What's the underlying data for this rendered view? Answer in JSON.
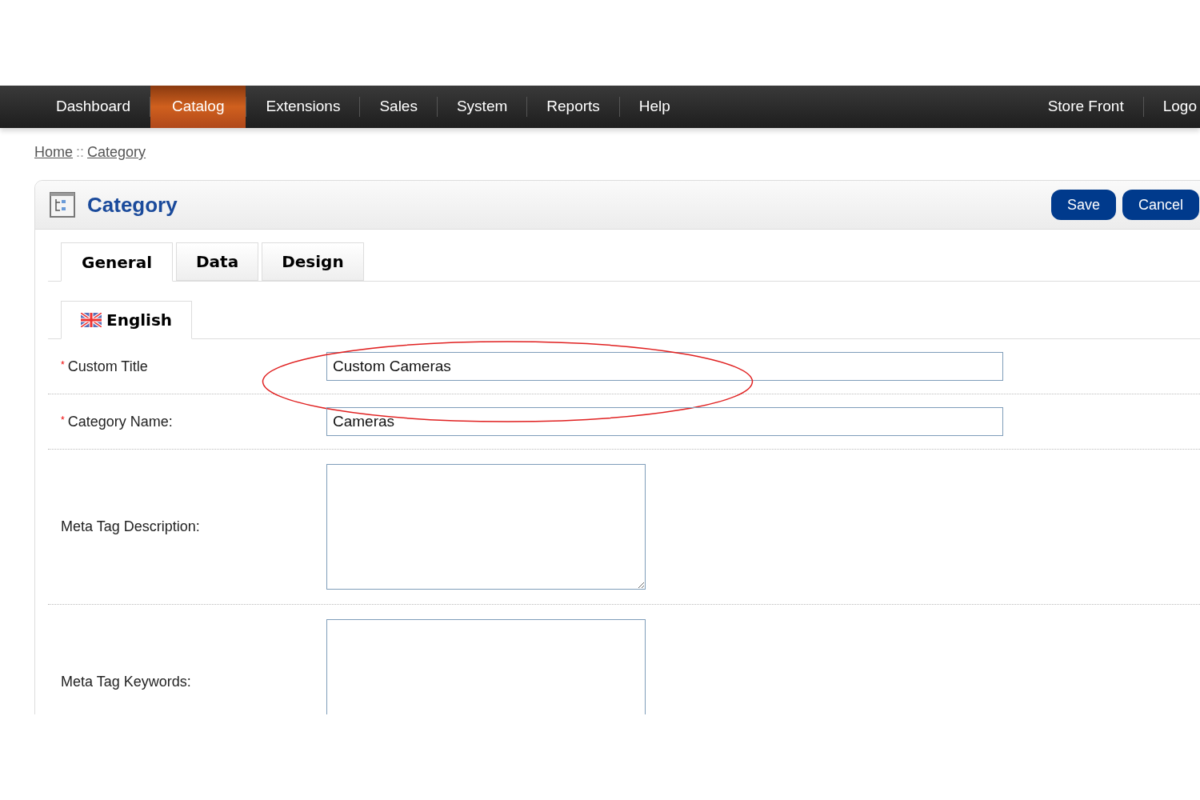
{
  "nav": {
    "left": [
      {
        "label": "Dashboard",
        "selected": false
      },
      {
        "label": "Catalog",
        "selected": true
      },
      {
        "label": "Extensions",
        "selected": false
      },
      {
        "label": "Sales",
        "selected": false
      },
      {
        "label": "System",
        "selected": false
      },
      {
        "label": "Reports",
        "selected": false
      },
      {
        "label": "Help",
        "selected": false
      }
    ],
    "right": [
      "Store Front",
      "Logo"
    ]
  },
  "breadcrumb": [
    "Home",
    "Category"
  ],
  "breadcrumb_separator": "::",
  "panel": {
    "title": "Category",
    "buttons": [
      "Save",
      "Cancel"
    ],
    "required_mark": "*",
    "tabs": [
      {
        "label": "General",
        "selected": true
      },
      {
        "label": "Data",
        "selected": false
      },
      {
        "label": "Design",
        "selected": false
      }
    ],
    "language_tabs": [
      {
        "label": "English",
        "selected": true
      }
    ],
    "fields": [
      {
        "kind": "input",
        "label": "Custom Title",
        "required": true,
        "value": "Custom Cameras",
        "highlighted": true
      },
      {
        "kind": "input",
        "label": "Category Name:",
        "required": true,
        "value": "Cameras",
        "highlighted": false
      },
      {
        "kind": "textarea",
        "label": "Meta Tag Description:",
        "required": false,
        "highlighted": false
      },
      {
        "kind": "textarea",
        "label": "Meta Tag Keywords:",
        "required": false,
        "highlighted": false
      }
    ]
  }
}
